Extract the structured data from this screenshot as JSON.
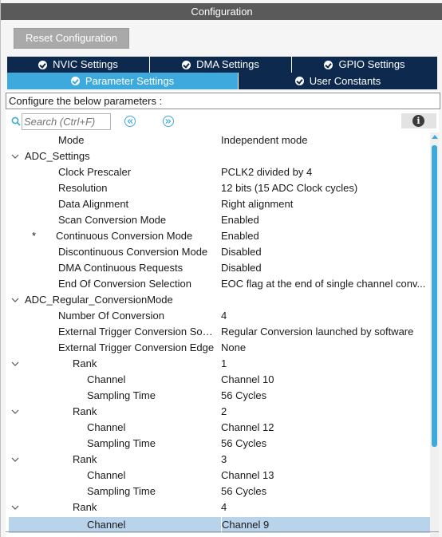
{
  "window": {
    "title": "Configuration"
  },
  "toolbar": {
    "reset_label": "Reset Configuration"
  },
  "tabs_row1": [
    {
      "label": "NVIC Settings"
    },
    {
      "label": "DMA Settings"
    },
    {
      "label": "GPIO Settings"
    }
  ],
  "tabs_row2": [
    {
      "label": "Parameter Settings",
      "active": true
    },
    {
      "label": "User Constants"
    }
  ],
  "config_prompt": "Configure the below parameters :",
  "search": {
    "placeholder": "Search (Ctrl+F)"
  },
  "tree": [
    {
      "name": "Mode",
      "value": "Independent mode"
    },
    {
      "name": "ADC_Settings",
      "value": ""
    },
    {
      "name": "Clock Prescaler",
      "value": "PCLK2 divided by 4"
    },
    {
      "name": "Resolution",
      "value": "12 bits (15 ADC Clock cycles)"
    },
    {
      "name": "Data Alignment",
      "value": "Right alignment"
    },
    {
      "name": "Scan Conversion Mode",
      "value": "Enabled"
    },
    {
      "name": "Continuous Conversion Mode",
      "value": "Enabled",
      "marker": "*"
    },
    {
      "name": "Discontinuous Conversion Mode",
      "value": "Disabled"
    },
    {
      "name": "DMA Continuous Requests",
      "value": "Disabled"
    },
    {
      "name": "End Of Conversion Selection",
      "value": "EOC flag at the end of single channel conv..."
    },
    {
      "name": "ADC_Regular_ConversionMode",
      "value": ""
    },
    {
      "name": "Number Of Conversion",
      "value": "4"
    },
    {
      "name": "External Trigger Conversion Sour...",
      "value": "Regular Conversion launched by software"
    },
    {
      "name": "External Trigger Conversion Edge",
      "value": "None"
    },
    {
      "name": "Rank",
      "value": "1"
    },
    {
      "name": "Channel",
      "value": "Channel 10"
    },
    {
      "name": "Sampling Time",
      "value": "56 Cycles"
    },
    {
      "name": "Rank",
      "value": "2"
    },
    {
      "name": "Channel",
      "value": "Channel 12"
    },
    {
      "name": "Sampling Time",
      "value": "56 Cycles"
    },
    {
      "name": "Rank",
      "value": "3"
    },
    {
      "name": "Channel",
      "value": "Channel 13"
    },
    {
      "name": "Sampling Time",
      "value": "56 Cycles"
    },
    {
      "name": "Rank",
      "value": "4"
    },
    {
      "name": "Channel",
      "value": "Channel 9"
    }
  ],
  "colors": {
    "tab_dark": "#0d2a4e",
    "tab_active": "#3ea9dd",
    "title_bar": "#5a5a5a",
    "selection": "#b9d3ea"
  }
}
